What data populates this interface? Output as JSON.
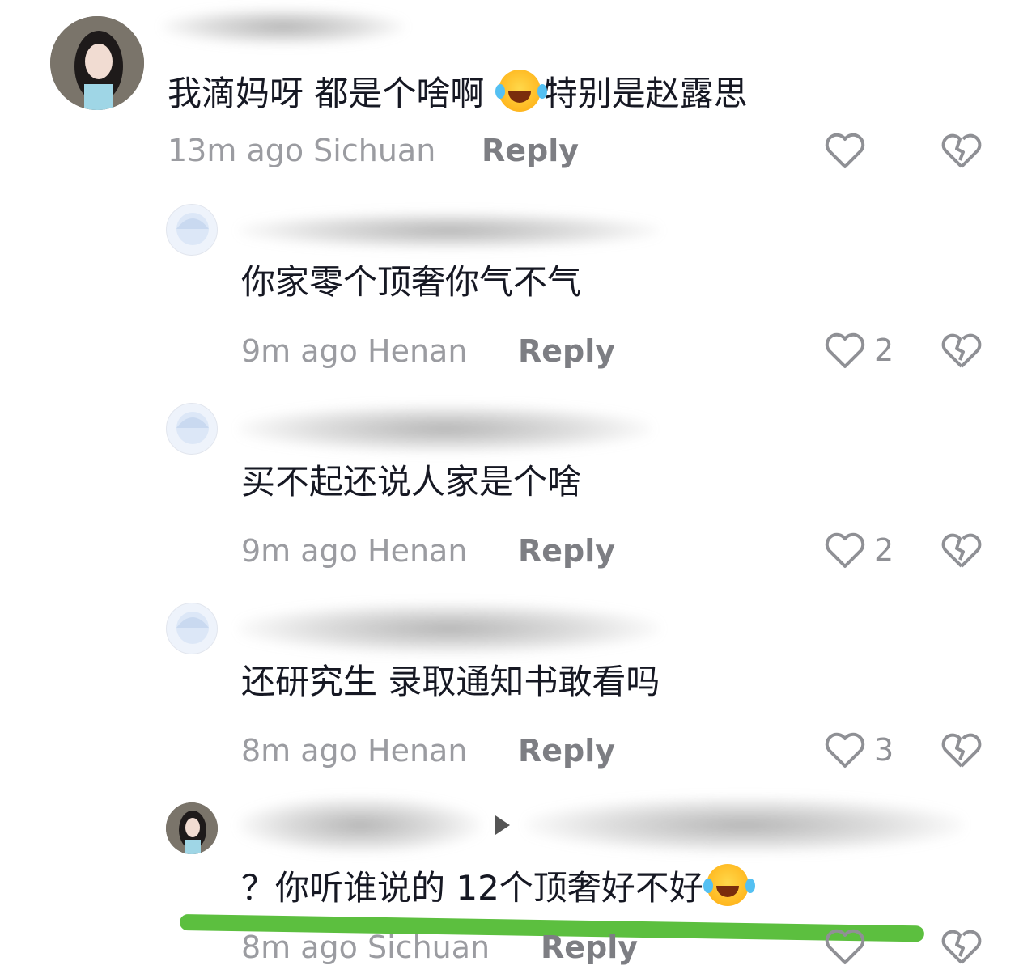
{
  "comments": [
    {
      "text_a": "我滴妈呀 都是个啥啊 ",
      "text_b": "特别是赵露思",
      "meta": "13m ago Sichuan",
      "reply": "Reply",
      "likes": ""
    },
    {
      "text": "你家零个顶奢你气不气",
      "meta": "9m ago Henan",
      "reply": "Reply",
      "likes": "2"
    },
    {
      "text": "买不起还说人家是个啥",
      "meta": "9m ago Henan",
      "reply": "Reply",
      "likes": "2"
    },
    {
      "text": "还研究生 录取通知书敢看吗",
      "meta": "8m ago Henan",
      "reply": "Reply",
      "likes": "3"
    },
    {
      "text": "？你听谁说的 12个顶奢好不好",
      "meta": "8m ago Sichuan",
      "reply": "Reply",
      "likes": ""
    }
  ],
  "colors": {
    "highlight_line": "#5cbf3f"
  }
}
